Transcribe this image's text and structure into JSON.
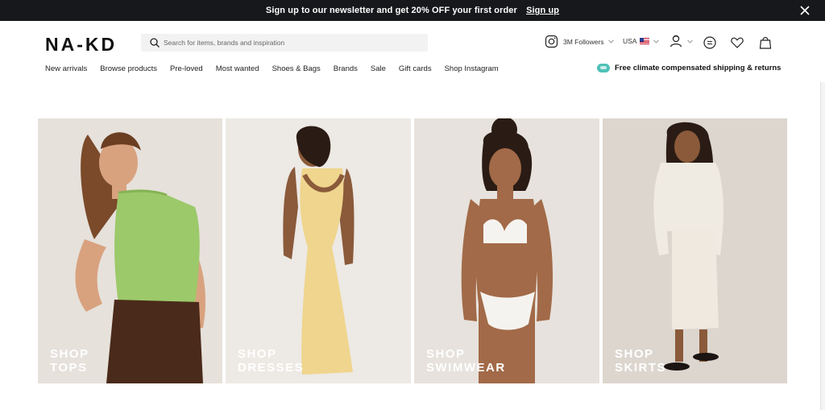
{
  "banner": {
    "message": "Sign up to our newsletter and get 20% OFF your first order",
    "cta": "Sign up"
  },
  "header": {
    "logo": "NA-KD",
    "search_placeholder": "Search for items, brands and inspiration",
    "instagram_followers": "3M Followers",
    "country": "USA"
  },
  "nav": {
    "items": [
      "New arrivals",
      "Browse products",
      "Pre-loved",
      "Most wanted",
      "Shoes & Bags",
      "Brands",
      "Sale",
      "Gift cards",
      "Shop Instagram"
    ]
  },
  "promo": {
    "text": "Free climate compensated shipping & returns"
  },
  "categories": [
    {
      "line1": "SHOP",
      "line2": "TOPS"
    },
    {
      "line1": "SHOP",
      "line2": "DRESSES"
    },
    {
      "line1": "SHOP",
      "line2": "SWIMWEAR"
    },
    {
      "line1": "SHOP",
      "line2": "SKIRTS"
    }
  ],
  "colors": {
    "banner_bg": "#16181b",
    "promo_badge": "#4fc1b6",
    "top_green": "#9cc96a",
    "pants_brown": "#4a2a1a",
    "dress_yellow": "#efd58d",
    "swim_white": "#f5f3ef",
    "cardigan_cream": "#f0ebe2"
  },
  "icons": [
    "search-icon",
    "instagram-icon",
    "flag-usa-icon",
    "account-icon",
    "chat-icon",
    "heart-icon",
    "bag-icon",
    "close-icon",
    "climate-badge-icon"
  ]
}
